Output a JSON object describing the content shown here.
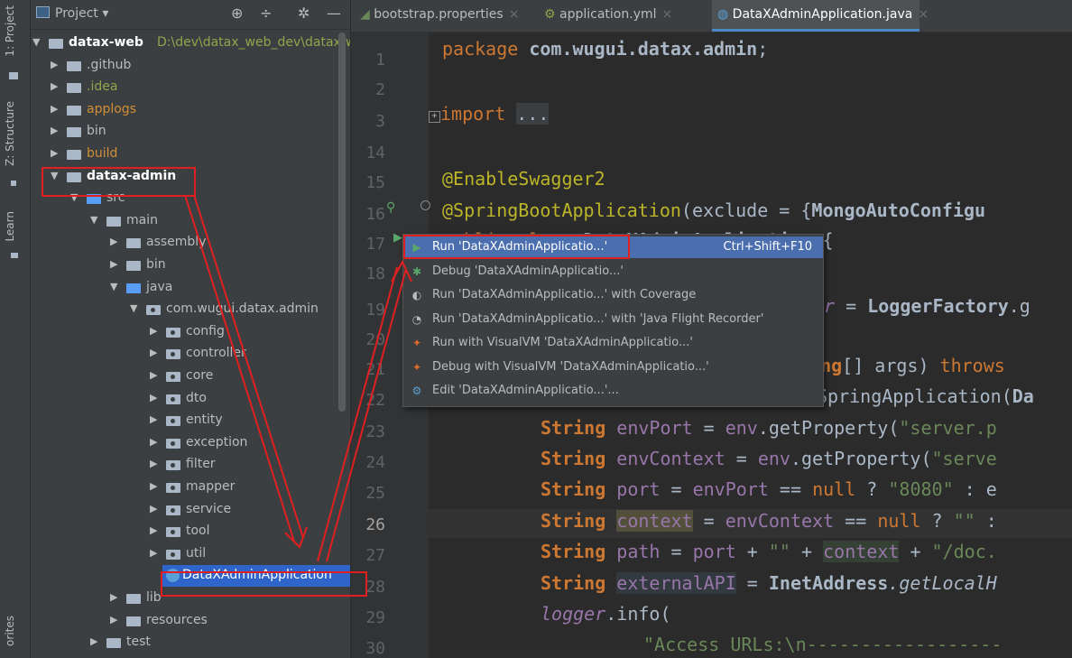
{
  "tool_strip": {
    "project_label": "1: Project",
    "structure_label": "Z: Structure",
    "learn_label": "Learn",
    "favorites_label": "orites"
  },
  "project_panel": {
    "title": "Project",
    "tree": [
      {
        "label": "datax-web",
        "path": "D:\\dev\\datax_web_dev\\datax-w",
        "arrow": "▼",
        "style": "bold"
      },
      {
        "label": ".github",
        "arrow": "▶",
        "style": "normal"
      },
      {
        "label": ".idea",
        "arrow": "▶",
        "style": "green"
      },
      {
        "label": "applogs",
        "arrow": "▶",
        "style": "orange"
      },
      {
        "label": "bin",
        "arrow": "▶",
        "style": "normal"
      },
      {
        "label": "build",
        "arrow": "▶",
        "style": "orange"
      },
      {
        "label": "datax-admin",
        "arrow": "▼",
        "style": "bold"
      },
      {
        "label": "src",
        "arrow": "▼",
        "style": "normal"
      },
      {
        "label": "main",
        "arrow": "▼",
        "style": "normal"
      },
      {
        "label": "assembly",
        "arrow": "▶",
        "style": "normal"
      },
      {
        "label": "bin",
        "arrow": "▶",
        "style": "normal"
      },
      {
        "label": "java",
        "arrow": "▼",
        "style": "normal"
      },
      {
        "label": "com.wugui.datax.admin",
        "arrow": "▼",
        "style": "normal"
      },
      {
        "label": "config",
        "arrow": "▶",
        "style": "normal"
      },
      {
        "label": "controller",
        "arrow": "▶",
        "style": "normal"
      },
      {
        "label": "core",
        "arrow": "▶",
        "style": "normal"
      },
      {
        "label": "dto",
        "arrow": "▶",
        "style": "normal"
      },
      {
        "label": "entity",
        "arrow": "▶",
        "style": "normal"
      },
      {
        "label": "exception",
        "arrow": "▶",
        "style": "normal"
      },
      {
        "label": "filter",
        "arrow": "▶",
        "style": "normal"
      },
      {
        "label": "mapper",
        "arrow": "▶",
        "style": "normal"
      },
      {
        "label": "service",
        "arrow": "▶",
        "style": "normal"
      },
      {
        "label": "tool",
        "arrow": "▶",
        "style": "normal"
      },
      {
        "label": "util",
        "arrow": "▶",
        "style": "normal"
      },
      {
        "label": "DataXAdminApplication",
        "arrow": "",
        "style": "normal"
      },
      {
        "label": "lib",
        "arrow": "▶",
        "style": "normal"
      },
      {
        "label": "resources",
        "arrow": "▶",
        "style": "normal"
      },
      {
        "label": "test",
        "arrow": "▶",
        "style": "normal"
      }
    ]
  },
  "tabs": [
    {
      "label": "bootstrap.properties"
    },
    {
      "label": "application.yml"
    },
    {
      "label": "DataXAdminApplication.java"
    }
  ],
  "editor": {
    "line_numbers": [
      "1",
      "2",
      "3",
      "14",
      "15",
      "16",
      "17",
      "18",
      "19",
      "20",
      "21",
      "22",
      "23",
      "24",
      "25",
      "26",
      "27",
      "28",
      "29",
      "30"
    ],
    "lines": {
      "l1_pkg": "package",
      "l1_name": "com.wugui.datax.admin",
      "l3_import": "import",
      "l3_fold": "...",
      "l15": "@EnableSwagger2",
      "l16_ann": "@SpringBootApplication",
      "l16_rest": "(exclude = {",
      "l16_cls": "MongoAutoConfigu",
      "l17_a": "public class ",
      "l17_b": "DataXAdminApplication",
      "l17_c": " {",
      "l19_a": "er",
      "l19_b": " = ",
      "l19_c": "LoggerFactory",
      "l19_d": ".g",
      "l21_a": "ring",
      "l21_b": "[] args) ",
      "l21_c": "throws",
      "l22_a": "SpringApplication(",
      "l22_b": "Da",
      "l23_a": "String ",
      "l23_b": "envPort",
      "l23_c": " = ",
      "l23_d": "env",
      "l23_e": ".getProperty(",
      "l23_f": "\"server.p",
      "l24_a": "String ",
      "l24_b": "envContext",
      "l24_c": " = ",
      "l24_d": "env",
      "l24_e": ".getProperty(",
      "l24_f": "\"serve",
      "l25_a": "String ",
      "l25_b": "port",
      "l25_c": " = ",
      "l25_d": "envPort",
      "l25_e": " == ",
      "l25_f": "null",
      "l25_g": " ? ",
      "l25_h": "\"8080\"",
      "l25_i": " : e",
      "l26_a": "String ",
      "l26_b": "context",
      "l26_c": " = ",
      "l26_d": "envContext",
      "l26_e": " == ",
      "l26_f": "null",
      "l26_g": " ? ",
      "l26_h": "\"\"",
      "l26_i": " :",
      "l27_a": "String ",
      "l27_b": "path",
      "l27_c": " = ",
      "l27_d": "port",
      "l27_e": " + ",
      "l27_f": "\"\"",
      "l27_g": " + ",
      "l27_h": "context",
      "l27_i": " + ",
      "l27_j": "\"/doc.",
      "l28_a": "String ",
      "l28_b": "externalAPI",
      "l28_c": " = ",
      "l28_d": "InetAddress",
      "l28_e": ".getLocalH",
      "l29_a": "logger",
      "l29_b": ".info(",
      "l30": "\"Access URLs:\\n------------------"
    }
  },
  "context_menu": {
    "items": [
      {
        "label": "Run 'DataXAdminApplicatio...'",
        "shortcut": "Ctrl+Shift+F10",
        "icon": "run-icon"
      },
      {
        "label": "Debug 'DataXAdminApplicatio...'",
        "shortcut": "",
        "icon": "debug-icon"
      },
      {
        "label": "Run 'DataXAdminApplicatio...' with Coverage",
        "shortcut": "",
        "icon": "coverage-icon"
      },
      {
        "label": "Run 'DataXAdminApplicatio...' with 'Java Flight Recorder'",
        "shortcut": "",
        "icon": "flight-recorder-icon"
      },
      {
        "label": "Run with VisualVM 'DataXAdminApplicatio...'",
        "shortcut": "",
        "icon": "visualvm-run-icon"
      },
      {
        "label": "Debug with VisualVM 'DataXAdminApplicatio...'",
        "shortcut": "",
        "icon": "visualvm-debug-icon"
      },
      {
        "label": "Edit 'DataXAdminApplicatio...'...",
        "shortcut": "",
        "icon": "edit-config-icon"
      }
    ]
  },
  "colors": {
    "annotation_red": "#e02020",
    "menu_selection": "#4b6eaf"
  }
}
